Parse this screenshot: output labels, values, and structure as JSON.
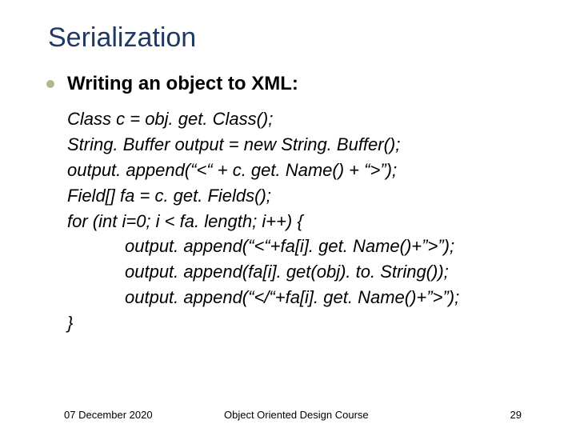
{
  "title": "Serialization",
  "subheading": "Writing an object to XML:",
  "code": {
    "l1": "Class c = obj. get. Class();",
    "l2": "String. Buffer output = new String. Buffer();",
    "l3": "output. append(“<“ + c. get. Name() + “>”);",
    "l4": "Field[] fa = c. get. Fields();",
    "l5": "for (int i=0; i < fa. length; i++) {",
    "l6": "output. append(“<“+fa[i]. get. Name()+”>”);",
    "l7": "output. append(fa[i]. get(obj). to. String());",
    "l8": "output. append(“</“+fa[i]. get. Name()+”>”);",
    "l9": "}"
  },
  "footer": {
    "date": "07 December 2020",
    "course": "Object Oriented Design Course",
    "page": "29"
  }
}
